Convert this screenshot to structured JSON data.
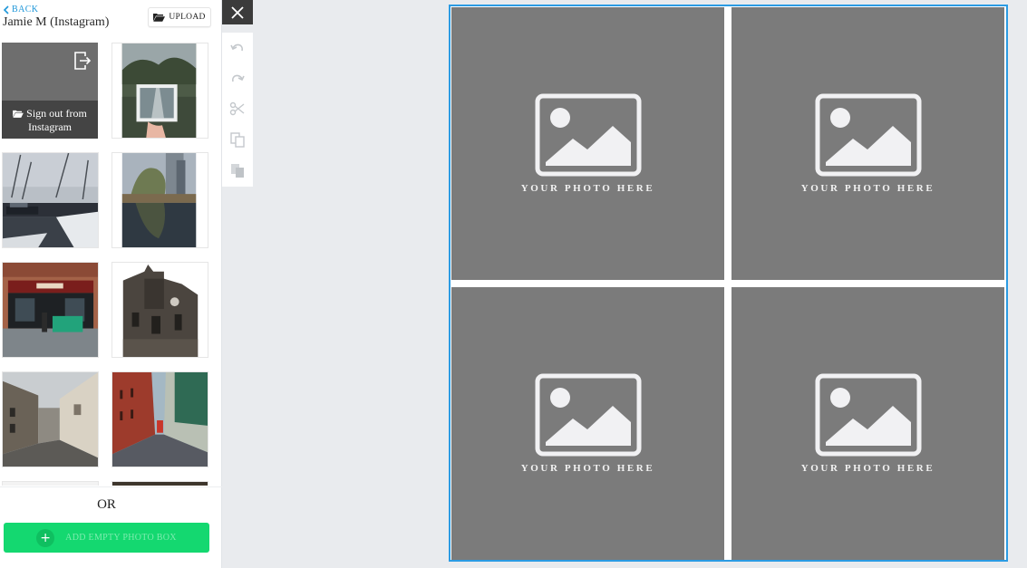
{
  "panel": {
    "back_label": "BACK",
    "account_name": "Jamie M (Instagram)",
    "upload_label": "UPLOAD",
    "sign_out_label": "Sign out from Instagram",
    "or_label": "OR",
    "add_empty_label": "ADD EMPTY PHOTO BOX",
    "add_icon": "+"
  },
  "canvas": {
    "slots": [
      {
        "caption": "YOUR PHOTO HERE"
      },
      {
        "caption": "YOUR PHOTO HERE"
      },
      {
        "caption": "YOUR PHOTO HERE"
      },
      {
        "caption": "YOUR PHOTO HERE"
      }
    ]
  },
  "toolbar": {
    "tools": [
      "undo-icon",
      "redo-icon",
      "scissors-icon",
      "copy-icon",
      "paste-icon"
    ]
  },
  "colors": {
    "accent": "#1d96d9",
    "selection_border": "#2b9be3",
    "add_button": "#14d870",
    "slot_fill": "#7b7b7b"
  }
}
